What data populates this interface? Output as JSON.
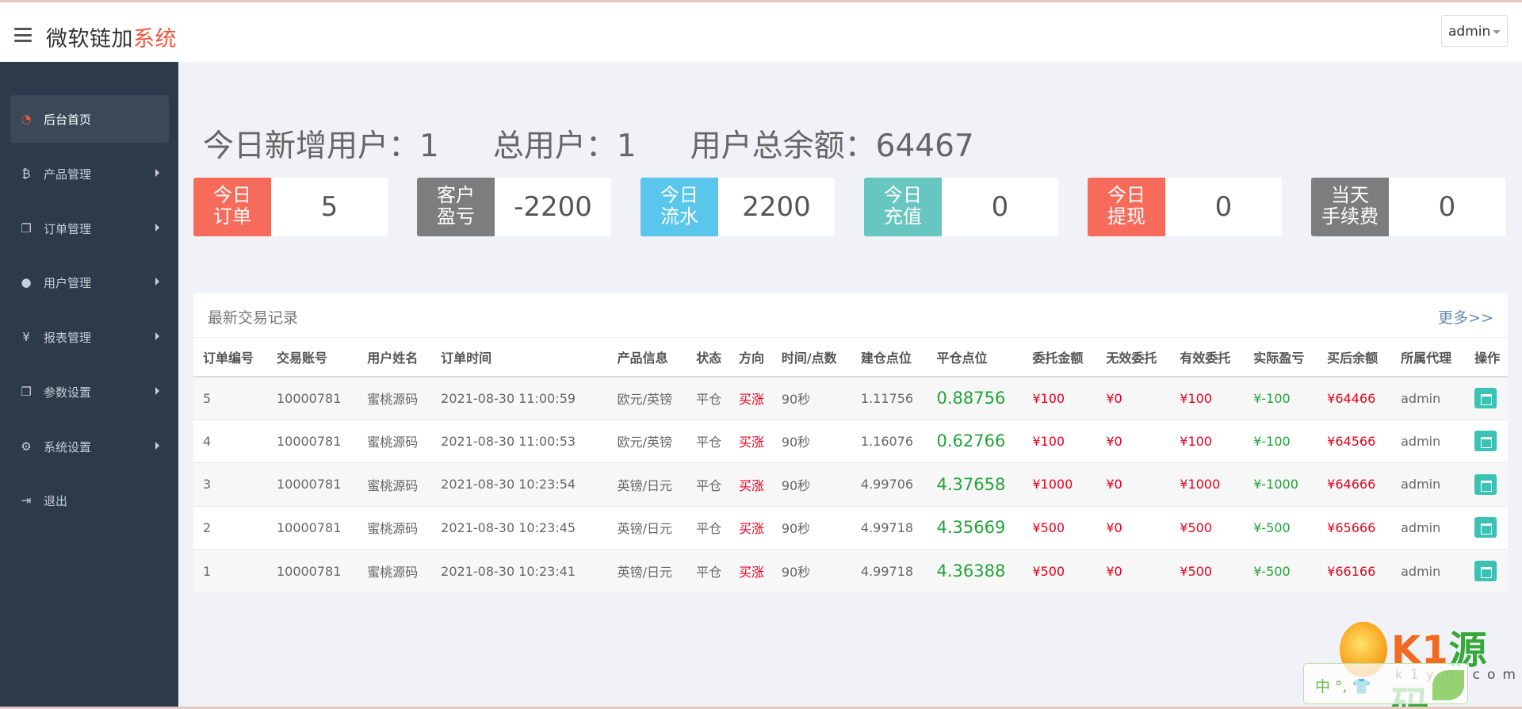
{
  "header": {
    "brand_main": "微软链加",
    "brand_accent": "系统",
    "user": "admin"
  },
  "sidebar": {
    "items": [
      {
        "label": "后台首页",
        "icon": "dashboard-icon",
        "active": true
      },
      {
        "label": "产品管理",
        "icon": "bitcoin-icon"
      },
      {
        "label": "订单管理",
        "icon": "copy-icon"
      },
      {
        "label": "用户管理",
        "icon": "user-icon"
      },
      {
        "label": "报表管理",
        "icon": "yen-icon"
      },
      {
        "label": "参数设置",
        "icon": "copy-icon"
      },
      {
        "label": "系统设置",
        "icon": "gears-icon"
      },
      {
        "label": "退出",
        "icon": "sign-out-icon"
      }
    ]
  },
  "summary": {
    "new_users": "今日新增用户：1",
    "total_users": "总用户：1",
    "total_balance": "用户总余额：64467"
  },
  "stats": [
    {
      "line1": "今日",
      "line2": "订单",
      "value": "5",
      "color": "#f76b5b"
    },
    {
      "line1": "客户",
      "line2": "盈亏",
      "value": "-2200",
      "color": "#7d7d7d"
    },
    {
      "line1": "今日",
      "line2": "流水",
      "value": "2200",
      "color": "#5ac6ec"
    },
    {
      "line1": "今日",
      "line2": "充值",
      "value": "0",
      "color": "#68c6c1"
    },
    {
      "line1": "今日",
      "line2": "提现",
      "value": "0",
      "color": "#f76b5b"
    },
    {
      "line1": "当天",
      "line2": "手续费",
      "value": "0",
      "color": "#7d7d7d"
    }
  ],
  "trades": {
    "title": "最新交易记录",
    "more": "更多>>",
    "columns": [
      "订单编号",
      "交易账号",
      "用户姓名",
      "订单时间",
      "产品信息",
      "状态",
      "方向",
      "时间/点数",
      "建仓点位",
      "平仓点位",
      "委托金额",
      "无效委托",
      "有效委托",
      "实际盈亏",
      "买后余额",
      "所属代理",
      "操作"
    ],
    "rows": [
      [
        "5",
        "10000781",
        "蜜桃源码",
        "2021-08-30 11:00:59",
        "欧元/英镑",
        "平仓",
        "买涨",
        "90秒",
        "1.11756",
        "0.88756",
        "¥100",
        "¥0",
        "¥100",
        "¥-100",
        "¥64466",
        "admin"
      ],
      [
        "4",
        "10000781",
        "蜜桃源码",
        "2021-08-30 11:00:53",
        "欧元/英镑",
        "平仓",
        "买涨",
        "90秒",
        "1.16076",
        "0.62766",
        "¥100",
        "¥0",
        "¥100",
        "¥-100",
        "¥64566",
        "admin"
      ],
      [
        "3",
        "10000781",
        "蜜桃源码",
        "2021-08-30 10:23:54",
        "英镑/日元",
        "平仓",
        "买涨",
        "90秒",
        "4.99706",
        "4.37658",
        "¥1000",
        "¥0",
        "¥1000",
        "¥-1000",
        "¥64666",
        "admin"
      ],
      [
        "2",
        "10000781",
        "蜜桃源码",
        "2021-08-30 10:23:45",
        "英镑/日元",
        "平仓",
        "买涨",
        "90秒",
        "4.99718",
        "4.35669",
        "¥500",
        "¥0",
        "¥500",
        "¥-500",
        "¥65666",
        "admin"
      ],
      [
        "1",
        "10000781",
        "蜜桃源码",
        "2021-08-30 10:23:41",
        "英镑/日元",
        "平仓",
        "买涨",
        "90秒",
        "4.99718",
        "4.36388",
        "¥500",
        "¥0",
        "¥500",
        "¥-500",
        "¥66166",
        "admin"
      ]
    ]
  },
  "watermark": {
    "logo_a": "K1",
    "logo_b": "源码",
    "url": "k1ym.com",
    "ime": "中 °, 👕"
  }
}
